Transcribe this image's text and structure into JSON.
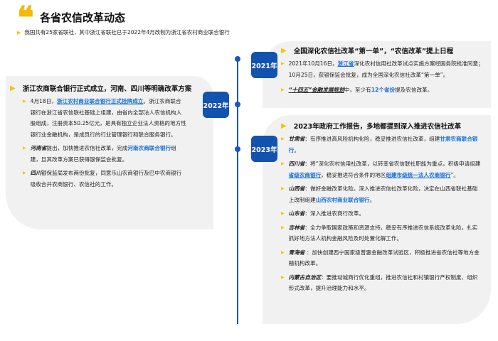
{
  "header": {
    "title": "各省农信改革动态",
    "subtitle": "我国共有25家省联社，其中浙江省联社已于2022年4月改制为浙江省农村商业联合银行"
  },
  "timeline": {
    "y2021": "2021年",
    "y2022": "2022年",
    "y2023": "2023年"
  },
  "p2021": {
    "heading": "全国深化农信社改革“第一单”，“农信改革”提上日程",
    "i1": {
      "a": "2021年10月16日，",
      "b": "浙江省",
      "c": "深化农村信用社改革试点实施方案经国务院批准同意；10月25日，获银保监会批复，成为全国深化农信社改革“第一单”。"
    },
    "i2": {
      "a": "“十四五”金融发展规划",
      "b": "中，至少有",
      "c": "12个省份",
      "d": "提及农信改革。"
    }
  },
  "p2022": {
    "heading": "浙江农商联合银行正式成立，河南、四川等明确改革方案",
    "i1": {
      "a": "4月18日，",
      "b": "浙江农村商业联合银行正式挂牌成立",
      "c": "。浙江农商联合银行在浙江省农信联社基础上组建，由省内全部法人农信机构入股组成，注册资本50.25亿元，是具有独立企业法人资格的地方性银行业金融机构，是成员行的行业管理银行和联合服务银行。"
    },
    "i2": {
      "a": "河南省",
      "b": "提出，加快推进农信社改革，完成",
      "c": "河南农商联合银行",
      "d": "组建，且其改革方案已获得银保监会批复。"
    },
    "i3": {
      "a": "四川",
      "b": "银保监局发布两份批复，同意乐山农商银行及巴中农商银行吸收合并农商银行、农信社的工作。"
    }
  },
  "p2023": {
    "heading": "2023年政府工作报告，多地都提到深入推进农信社改革",
    "gansu": {
      "a": "甘肃省",
      "b": "：有序推进高风险机构化险，稳妥推进农信社改革，组建",
      "c": "甘肃农商联合银行",
      "d": "。"
    },
    "sichuan": {
      "a": "四川省",
      "b": "：将“深化农村信用社改革，以转变省农信联社职能为重点，积极申请组建",
      "c": "省级农商银行",
      "d": "，稳妥推进符合条件的地区",
      "e": "组建市级统一法人农商银行",
      "f": "”。"
    },
    "shanxi": {
      "a": "山西省",
      "b": "：做好金融改革化险。深入推进农信社改革化险，决定在山西省联社基础上改制组建",
      "c": "山西农村商业联合银行",
      "d": "。"
    },
    "shandong": {
      "a": "山东省",
      "b": "：深入推进农商行改革。"
    },
    "jilin": {
      "a": "吉林省",
      "b": "：全力争取国家政策和资源支持，稳妥有序推进农信系统改革化险，扎实抓好地方法人机构金融风险及时处置化解工作。"
    },
    "qinghai": {
      "a": "青海省",
      "b": " ：加快创建西宁国家级普惠金融改革试验区，积极推进省农信社等地方金融机构改革。"
    },
    "neimeng": {
      "a": "内蒙古自治区",
      "b": "：要推动城商行优化重组，推进农信社和村镇银行产权制度、组织形式改革，提升治理能力和水平。"
    }
  },
  "colors": {
    "accent": "#f5b800",
    "badge": "#1353b0",
    "link": "#1a6fd6",
    "panel": "#f1f1f1"
  }
}
